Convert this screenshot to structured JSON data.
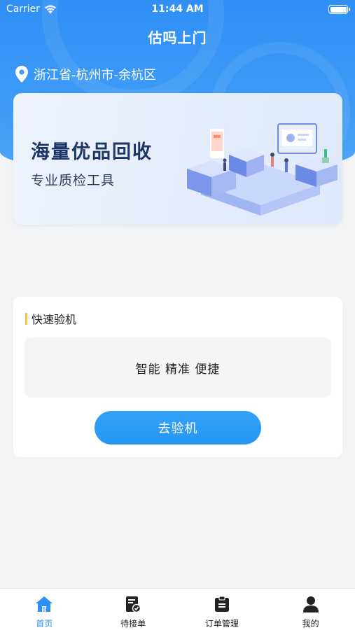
{
  "status_bar": {
    "carrier": "Carrier",
    "time": "11:44 AM"
  },
  "header": {
    "title": "估吗上门"
  },
  "location": {
    "text": "浙江省-杭州市-余杭区"
  },
  "banner": {
    "title": "海量优品回收",
    "subtitle": "专业质检工具"
  },
  "quick_check": {
    "section_title": "快速验机",
    "features": "智能 精准 便捷",
    "button_label": "去验机"
  },
  "tabbar": {
    "items": [
      {
        "label": "首页",
        "icon": "home-icon",
        "active": true
      },
      {
        "label": "待接单",
        "icon": "pending-order-icon",
        "active": false
      },
      {
        "label": "订单管理",
        "icon": "clipboard-icon",
        "active": false
      },
      {
        "label": "我的",
        "icon": "user-icon",
        "active": false
      }
    ]
  },
  "colors": {
    "primary": "#2f8ff5",
    "accent_bar": "#f6c443",
    "banner_title": "#1b3766"
  }
}
